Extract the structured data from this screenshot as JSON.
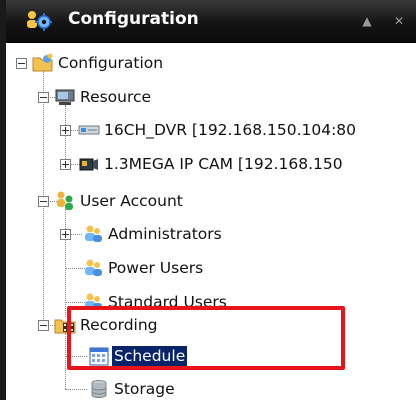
{
  "window": {
    "title": "Configuration",
    "title_icon": "gear-users-icon",
    "buttons": {
      "menu_glyph": "▲",
      "close_glyph": "✕"
    }
  },
  "tree": {
    "root": {
      "label": "Configuration",
      "icon": "folder-config-icon",
      "expanded": true
    },
    "resource": {
      "label": "Resource",
      "icon": "server-icon",
      "expanded": true
    },
    "resource_items": [
      {
        "label": "16CH_DVR [192.168.150.104:80",
        "icon": "dvr-icon",
        "expanded": false
      },
      {
        "label": "1.3MEGA IP CAM [192.168.150",
        "icon": "ip-camera-icon",
        "expanded": false
      }
    ],
    "user_account": {
      "label": "User Account",
      "icon": "users-icon",
      "expanded": true
    },
    "user_items": [
      {
        "label": "Administrators",
        "icon": "user-group-icon",
        "expanded": false
      },
      {
        "label": "Power Users",
        "icon": "user-group-icon"
      },
      {
        "label": "Standard Users",
        "icon": "user-group-icon"
      }
    ],
    "recording": {
      "label": "Recording",
      "icon": "film-folder-icon",
      "expanded": true
    },
    "recording_items": [
      {
        "label": "Schedule",
        "icon": "calendar-icon",
        "selected": true
      },
      {
        "label": "Storage",
        "icon": "database-icon"
      }
    ]
  },
  "colors": {
    "highlight": "#e8141c",
    "selection": "#0a246a",
    "titlebar": "#141414"
  }
}
